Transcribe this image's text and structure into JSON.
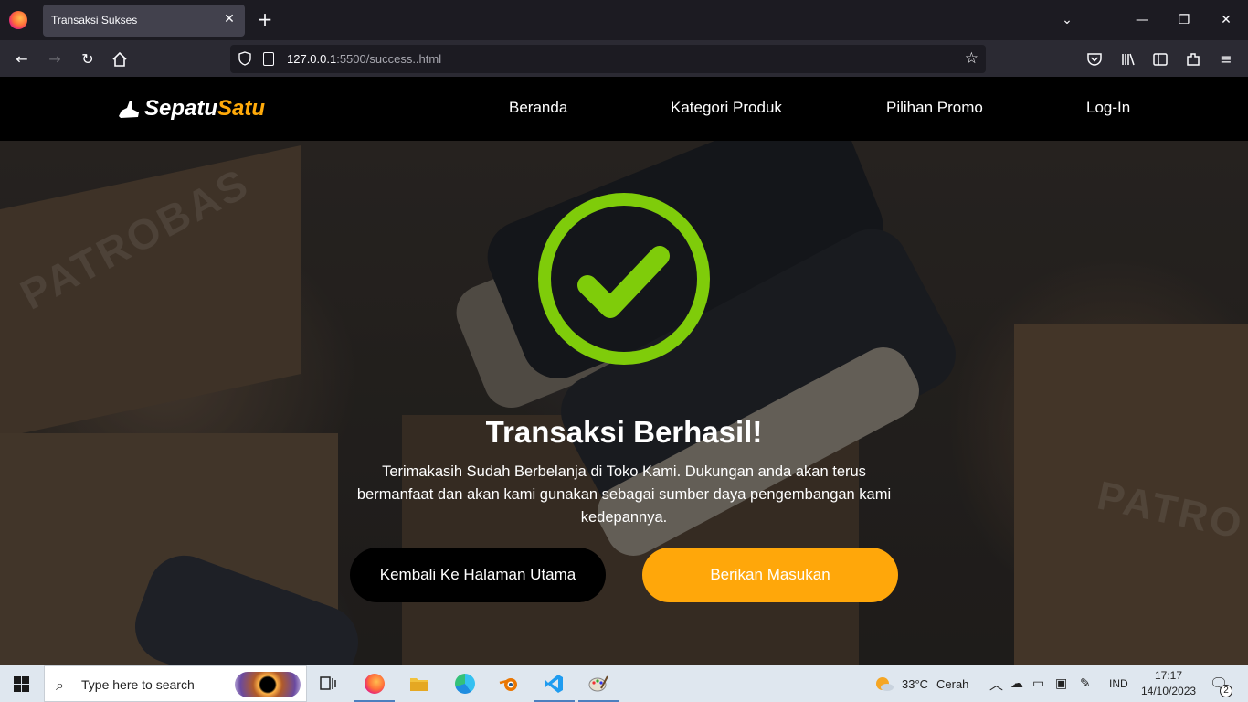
{
  "browser": {
    "tab_title": "Transaksi Sukses",
    "tab_close_icon": "close-icon",
    "new_tab_icon": "plus-icon",
    "url_host": "127.0.0.1",
    "url_rest": ":5500/success..html"
  },
  "site": {
    "logo_part1": "Sepatu",
    "logo_part2": "Satu",
    "menu": [
      "Beranda",
      "Kategori Produk",
      "Pilihan Promo",
      "Log-In"
    ],
    "accent_color": "#ffa70a"
  },
  "success": {
    "title": "Transaksi Berhasil!",
    "description": "Terimakasih Sudah Berbelanja di Toko Kami. Dukungan anda akan terus bermanfaat dan akan kami gunakan sebagai sumber daya pengembangan kami kedepannya.",
    "check_color": "#7fcc0a",
    "btn_home": "Kembali Ke Halaman Utama",
    "btn_feedback": "Berikan Masukan"
  },
  "taskbar": {
    "search_placeholder": "Type here to search",
    "weather_temp": "33°C",
    "weather_desc": "Cerah",
    "language": "IND",
    "time": "17:17",
    "date": "14/10/2023",
    "notification_count": "2"
  }
}
